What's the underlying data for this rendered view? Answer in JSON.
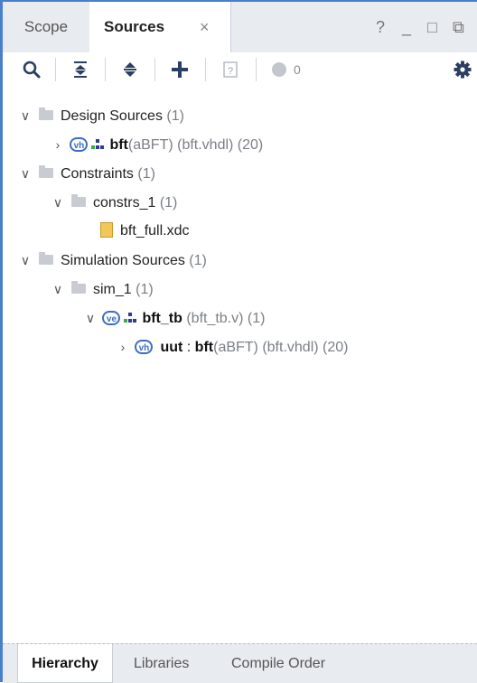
{
  "tabs": {
    "scope_label": "Scope",
    "sources_label": "Sources",
    "close_glyph": "×"
  },
  "window_controls": {
    "help": "?",
    "minimize": "_",
    "maximize": "□",
    "restore": "⧉"
  },
  "toolbar": {
    "search_icon": "search-icon",
    "collapse_icon": "collapse-all-icon",
    "expand_icon": "expand-all-icon",
    "add_icon": "add-icon",
    "unknown_icon": "question-box-icon",
    "status_count": "0",
    "settings_icon": "gear-icon"
  },
  "tree": {
    "design_sources": {
      "label": "Design Sources",
      "count": "(1)"
    },
    "bft": {
      "name": "bft",
      "detail": "(aBFT) (bft.vhdl) (20)"
    },
    "constraints": {
      "label": "Constraints",
      "count": "(1)"
    },
    "constrs_1": {
      "label": "constrs_1",
      "count": "(1)"
    },
    "bft_full": {
      "label": "bft_full.xdc"
    },
    "simulation_sources": {
      "label": "Simulation Sources",
      "count": "(1)"
    },
    "sim_1": {
      "label": "sim_1",
      "count": "(1)"
    },
    "bft_tb": {
      "name": "bft_tb",
      "detail": "(bft_tb.v) (1)"
    },
    "uut": {
      "name": "uut",
      "sep": " : ",
      "entity": "bft",
      "detail": "(aBFT) (bft.vhdl) (20)"
    }
  },
  "bottom_tabs": {
    "hierarchy": "Hierarchy",
    "libraries": "Libraries",
    "compile_order": "Compile Order"
  },
  "colors": {
    "frame_accent": "#4a7fc9",
    "badge_blue": "#3b6fc2",
    "panel_bg": "#e8ecf1"
  }
}
